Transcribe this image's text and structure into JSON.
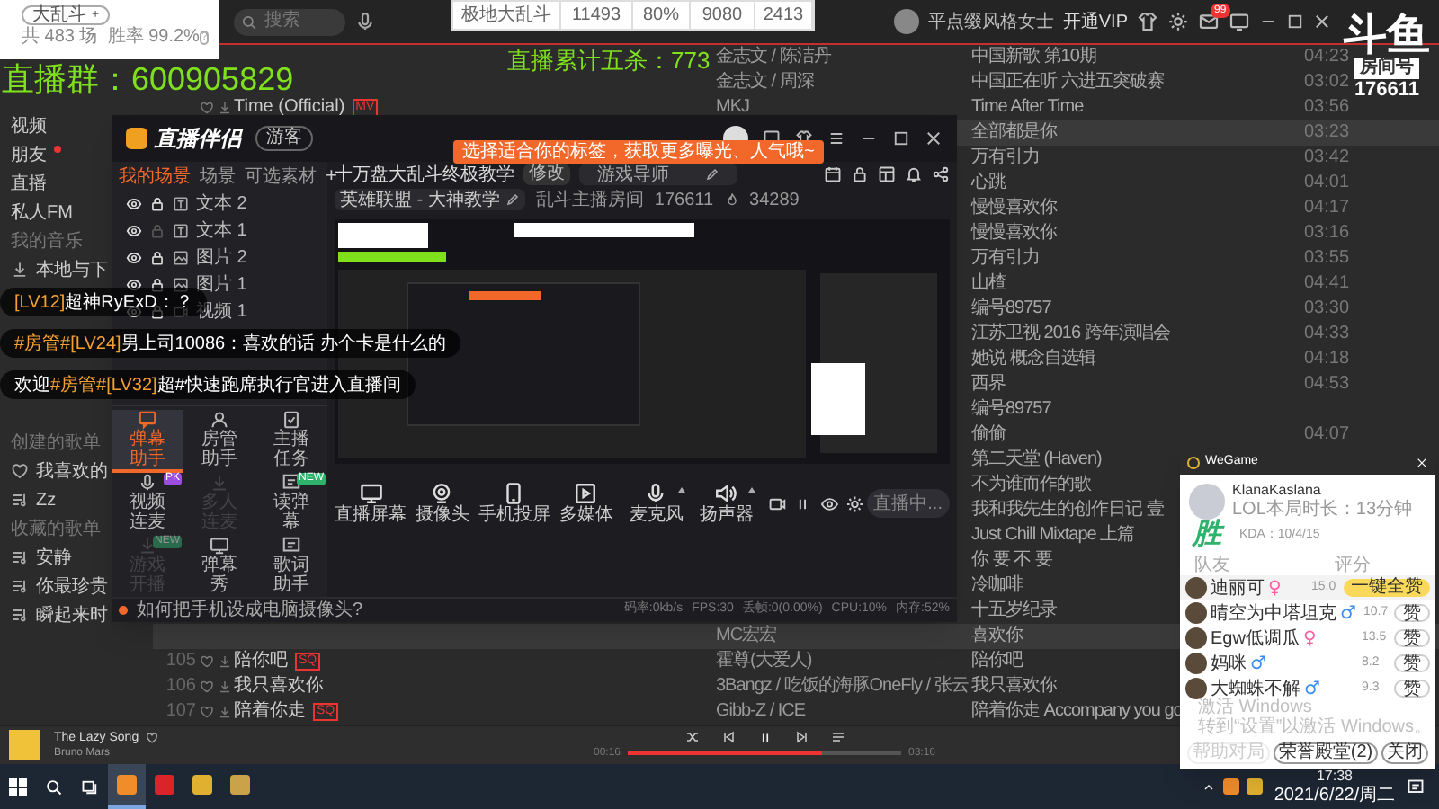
{
  "music": {
    "search": {
      "placeholder": "搜索"
    },
    "account": {
      "name": "平点缀风格女士",
      "vip": "开通VIP",
      "mail_badge": "99"
    },
    "sidebar": [
      {
        "kind": "video",
        "label": "视频",
        "new": false
      },
      {
        "kind": "friends",
        "label": "朋友",
        "new": true
      },
      {
        "kind": "live",
        "label": "直播",
        "new": false
      },
      {
        "kind": "fm",
        "label": "私人FM",
        "new": false
      },
      {
        "kind": "header",
        "label": "我的音乐",
        "new": false
      },
      {
        "kind": "local",
        "label": "本地与下",
        "new": false
      },
      {
        "kind": "header",
        "label": "创建的歌单",
        "new": false
      },
      {
        "kind": "liked",
        "label": "我喜欢的",
        "new": false
      },
      {
        "kind": "playlist",
        "label": "Zz",
        "new": false
      },
      {
        "kind": "header",
        "label": "收藏的歌单",
        "new": false
      },
      {
        "kind": "playlist",
        "label": "安静",
        "new": false
      },
      {
        "kind": "playlist",
        "label": "你最珍贵",
        "new": false
      },
      {
        "kind": "playlist",
        "label": "瞬起来时",
        "new": false
      }
    ],
    "songs": [
      {
        "artist": "金志文 / 陈洁丹",
        "album": "中国新歌 第10期",
        "duration": "04:23",
        "selected": false
      },
      {
        "artist": "金志文 / 周深",
        "album": "中国正在听 六进五突破赛",
        "duration": "03:02",
        "selected": false
      },
      {
        "title": "Time (Official)",
        "title_badge": "MV",
        "artist": "MKJ",
        "album": "Time After Time",
        "duration": "03:56",
        "selected": false
      },
      {
        "album": "全部都是你",
        "duration": "03:23",
        "selected": true
      },
      {
        "album": "万有引力",
        "duration": "03:42",
        "selected": false
      },
      {
        "album": "心跳",
        "duration": "04:01",
        "selected": false
      },
      {
        "album": "慢慢喜欢你",
        "duration": "04:17",
        "selected": false
      },
      {
        "album": "慢慢喜欢你",
        "duration": "03:16",
        "selected": false
      },
      {
        "album": "万有引力",
        "duration": "03:55",
        "selected": false
      },
      {
        "album": "山楂",
        "duration": "04:41",
        "selected": false
      },
      {
        "album": "编号89757",
        "duration": "03:30",
        "selected": false
      },
      {
        "album": "江苏卫视 2016 跨年演唱会",
        "duration": "04:33",
        "selected": false
      },
      {
        "album": "她说 概念自选辑",
        "duration": "04:18",
        "selected": false
      },
      {
        "album": "西界",
        "duration": "04:53",
        "selected": false
      },
      {
        "album": "编号89757",
        "selected": false
      },
      {
        "album": "偷偷",
        "duration": "04:07",
        "selected": false
      },
      {
        "album": "第二天堂 (Haven)",
        "selected": false
      },
      {
        "album": "不为谁而作的歌",
        "selected": false
      },
      {
        "album": "我和我先生的创作日记 壹",
        "selected": false
      },
      {
        "album": "Just Chill Mixtape 上篇",
        "selected": false
      },
      {
        "album": "你 要 不 要",
        "selected": false
      },
      {
        "album": "冷咖啡",
        "selected": false
      },
      {
        "album": "十五岁纪录",
        "selected": false
      },
      {
        "artist": "MC宏宏",
        "album": "喜欢你",
        "selected": true
      },
      {
        "number": "105",
        "title": "陪你吧",
        "title_badge": "SQ",
        "artist": "霍尊(大爱人)",
        "album": "陪你吧",
        "selected": false
      },
      {
        "number": "106",
        "title": "我只喜欢你",
        "artist": "3Bangz / 吃饭的海豚OneFly / 张云",
        "album": "我只喜欢你",
        "selected": false
      },
      {
        "number": "107",
        "title": "陪着你走",
        "title_badge": "SQ",
        "artist": "Gibb-Z / ICE",
        "album": "陪着你走 Accompany you go",
        "selected": false
      }
    ],
    "player": {
      "title": "The Lazy Song",
      "artist": "Bruno Mars",
      "liked": false,
      "elapsed": "00:16",
      "total": "03:16",
      "level": 0.71
    }
  },
  "stats_card": {
    "mode": "大乱斗",
    "add": "+",
    "summary": "共 483 场  胜率 99.2%",
    "help": "?"
  },
  "stats_table": [
    "极地大乱斗",
    "11493",
    "80%",
    "9080",
    "2413"
  ],
  "group_banner": "直播群：600905829",
  "pentakill_banner": "直播累计五杀：773",
  "douyu": {
    "logo": "斗鱼",
    "room_label": "房间号",
    "room_number": "176611"
  },
  "chat": [
    {
      "segments": [
        {
          "kind": "tag",
          "text": "[LV12]"
        },
        {
          "kind": "text",
          "text": "超神RyExD：？"
        }
      ]
    },
    {
      "segments": [
        {
          "kind": "tag",
          "text": "#房管#[LV24]"
        },
        {
          "kind": "text",
          "text": "男上司10086：喜欢的话 办个卡是什么的"
        }
      ]
    },
    {
      "segments": [
        {
          "kind": "text",
          "text": "欢迎"
        },
        {
          "kind": "tag",
          "text": "#房管#[LV32]"
        },
        {
          "kind": "text",
          "text": "超#快速跑席执行官进入直播间"
        }
      ]
    }
  ],
  "companion": {
    "logo": "直播伴侣",
    "badge": "游客",
    "tip": "选择适合你的标签，获取更多曝光、人气哦~",
    "tabs": [
      {
        "label": "我的场景",
        "selected": true
      },
      {
        "label": "场景",
        "selected": false
      },
      {
        "label": "可选素材",
        "selected": false
      }
    ],
    "add": "+",
    "layers": [
      {
        "kind": "text",
        "label": "文本 2",
        "visible": true,
        "locked": true
      },
      {
        "kind": "text",
        "label": "文本 1",
        "visible": true,
        "locked": false
      },
      {
        "kind": "image",
        "label": "图片 2",
        "visible": true,
        "locked": true
      },
      {
        "kind": "image",
        "label": "图片 1",
        "visible": true,
        "locked": true
      },
      {
        "kind": "video",
        "label": "视频 1",
        "visible": true,
        "locked": true
      }
    ],
    "tools": [
      {
        "kind": "danmaku",
        "label": "弹幕助手",
        "selected": true,
        "disabled": false
      },
      {
        "kind": "moderator",
        "label": "房管助手",
        "selected": false,
        "disabled": false
      },
      {
        "kind": "task",
        "label": "主播任务",
        "selected": false,
        "disabled": false
      },
      {
        "kind": "videolink",
        "label": "视频连麦",
        "tag": "PK",
        "selected": false,
        "disabled": false
      },
      {
        "kind": "multilink",
        "label": "多人连麦",
        "selected": false,
        "disabled": true
      },
      {
        "kind": "readdanmaku",
        "label": "读弹幕",
        "tag": "NEW",
        "selected": false,
        "disabled": false
      },
      {
        "kind": "gamestart",
        "label": "游戏开播",
        "tag": "NEW",
        "selected": false,
        "disabled": true
      },
      {
        "kind": "danmakushow",
        "label": "弹幕秀",
        "selected": false,
        "disabled": false
      },
      {
        "kind": "lyrics",
        "label": "歌词助手",
        "selected": false,
        "disabled": false
      }
    ],
    "stream_title": "十万盘大乱斗终极教学",
    "edit": "修改",
    "category_tag": "游戏导师",
    "category": "英雄联盟 - 大神教学",
    "room": "乱斗主播房间",
    "room_id": "176611",
    "heat": "34289",
    "sources": [
      {
        "kind": "screen",
        "label": "直播屏幕",
        "dropdown": false
      },
      {
        "kind": "camera",
        "label": "摄像头",
        "dropdown": false
      },
      {
        "kind": "phone",
        "label": "手机投屏",
        "dropdown": false
      },
      {
        "kind": "media",
        "label": "多媒体",
        "dropdown": false
      },
      {
        "kind": "mic",
        "label": "麦克风",
        "dropdown": true
      },
      {
        "kind": "speaker",
        "label": "扬声器",
        "dropdown": true
      }
    ],
    "live_button": "直播中...",
    "help": "如何把手机设成电脑摄像头?",
    "stats": [
      "码率:0kb/s",
      "FPS:30",
      "丢帧:0(0.00%)",
      "CPU:10%",
      "内存:52%"
    ]
  },
  "wegame": {
    "title": "WeGame",
    "player": "KlanaKaslana",
    "duration": "LOL本局时长：13分钟",
    "result": "胜",
    "kda": "KDA：10/4/15",
    "col_team": "队友",
    "col_score": "评分",
    "teammates": [
      {
        "name": "迪丽可",
        "sign": "♀",
        "color": "#ff5fa2",
        "score": "15.0",
        "action": "一键全赞",
        "highlight": true
      },
      {
        "name": "晴空为中塔坦克",
        "sign": "♂",
        "color": "#3a8ef0",
        "score": "10.7",
        "action": "赞",
        "highlight": false
      },
      {
        "name": "Egw低调瓜",
        "sign": "♀",
        "color": "#ff5fa2",
        "score": "13.5",
        "action": "赞",
        "highlight": false
      },
      {
        "name": "妈咪",
        "sign": "♂",
        "color": "#3a8ef0",
        "score": "8.2",
        "action": "赞",
        "highlight": false
      },
      {
        "name": "大蜘蛛不解",
        "sign": "♂",
        "color": "#3a8ef0",
        "score": "9.3",
        "action": "赞",
        "highlight": false
      }
    ],
    "buttons": [
      {
        "label": "帮助对局",
        "disabled": true
      },
      {
        "label": "荣誉殿堂(2)",
        "disabled": false
      },
      {
        "label": "关闭",
        "disabled": false
      }
    ]
  },
  "activation": [
    "激活 Windows",
    "转到“设置”以激活 Windows。"
  ],
  "taskbar": {
    "apps": [
      {
        "kind": "companion",
        "active": true
      },
      {
        "kind": "netease",
        "active": false
      },
      {
        "kind": "game",
        "active": false
      },
      {
        "kind": "lol",
        "active": false
      }
    ],
    "time": "17:38",
    "date": "2021/6/22/周二"
  }
}
